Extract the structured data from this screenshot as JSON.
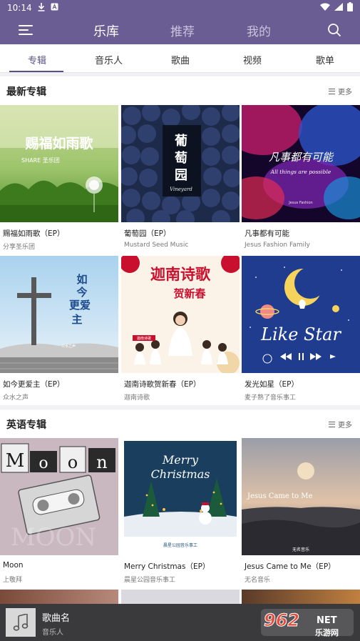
{
  "status": {
    "time": "10:14"
  },
  "nav": {
    "tabs": [
      {
        "label": "乐库"
      },
      {
        "label": "推荐"
      },
      {
        "label": "我的"
      }
    ],
    "active": 0
  },
  "subtabs": [
    {
      "label": "专辑"
    },
    {
      "label": "音乐人"
    },
    {
      "label": "歌曲"
    },
    {
      "label": "视频"
    },
    {
      "label": "歌单"
    }
  ],
  "sections": [
    {
      "title": "最新专辑",
      "more": "更多",
      "albums": [
        {
          "title": "赐福如雨歌（EP）",
          "artist": "分享圣乐团",
          "cover_text": [
            "赐福如雨歌",
            "SHARE 圣乐团"
          ]
        },
        {
          "title": "葡萄园（EP）",
          "artist": "Mustard Seed Music",
          "cover_text": [
            "葡萄园",
            "Vineyard"
          ]
        },
        {
          "title": "凡事都有可能",
          "artist": "Jesus Fashion Family",
          "cover_text": [
            "凡事都有可能",
            "All things are possible",
            "Jesus Fashion"
          ]
        },
        {
          "title": "如今更爱主（EP）",
          "artist": "众水之声",
          "cover_text": [
            "如今更爱主",
            "众水之声"
          ]
        },
        {
          "title": "迦南诗歌贺新春（EP）",
          "artist": "迦南诗歌",
          "cover_text": [
            "迦南诗歌",
            "贺新春",
            "迦南诗歌"
          ]
        },
        {
          "title": "发光如星（EP）",
          "artist": "麦子熟了音乐事工",
          "cover_text": [
            "Like Star"
          ]
        }
      ]
    },
    {
      "title": "英语专辑",
      "more": "更多",
      "albums": [
        {
          "title": "Moon",
          "artist": "上敬拜",
          "cover_text": [
            "Moon",
            "MOON"
          ]
        },
        {
          "title": "Merry Christmas（EP）",
          "artist": "晨星公园音乐事工",
          "cover_text": [
            "Merry",
            "Christmas",
            "晨星公园音乐事工"
          ]
        },
        {
          "title": "Jesus Came to Me（EP）",
          "artist": "无名音乐",
          "cover_text": [
            "Jesus Came to Me",
            "无名音乐"
          ]
        }
      ]
    }
  ],
  "player": {
    "song": "歌曲名",
    "artist": "音乐人",
    "icon": "music-note-icon"
  },
  "watermark": {
    "text": "962",
    "suffix": "NET",
    "subtext": "乐游网"
  },
  "colors": {
    "brand": "#6a5d94",
    "accent": "#5a4f86",
    "player": "#3a3a3c"
  }
}
